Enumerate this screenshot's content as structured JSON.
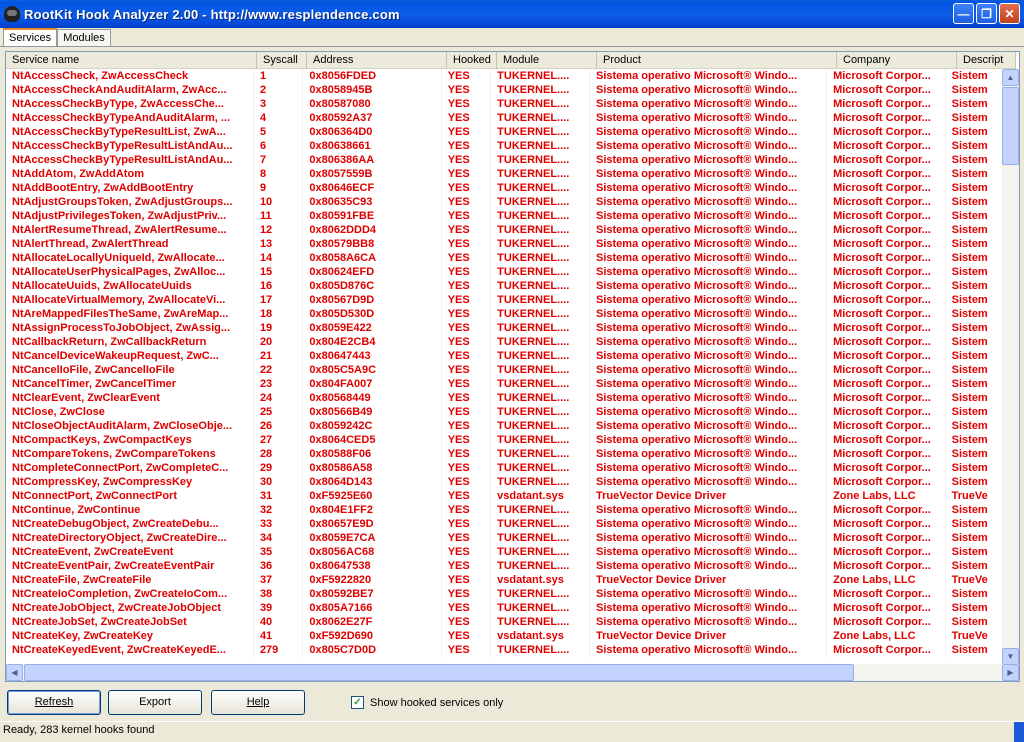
{
  "window": {
    "title": "RootKit Hook Analyzer 2.00 - http://www.resplendence.com"
  },
  "tabs": [
    {
      "label": "Services"
    },
    {
      "label": "Modules"
    }
  ],
  "columns": [
    {
      "label": "Service name"
    },
    {
      "label": "Syscall"
    },
    {
      "label": "Address"
    },
    {
      "label": "Hooked"
    },
    {
      "label": "Module"
    },
    {
      "label": "Product"
    },
    {
      "label": "Company"
    },
    {
      "label": "Descript"
    }
  ],
  "rows": [
    [
      "NtAccessCheck, ZwAccessCheck",
      "1",
      "0x8056FDED",
      "YES",
      "TUKERNEL....",
      "Sistema operativo Microsoft® Windo...",
      "Microsoft Corpor...",
      "Sistem"
    ],
    [
      "NtAccessCheckAndAuditAlarm, ZwAcc...",
      "2",
      "0x8058945B",
      "YES",
      "TUKERNEL....",
      "Sistema operativo Microsoft® Windo...",
      "Microsoft Corpor...",
      "Sistem"
    ],
    [
      "NtAccessCheckByType, ZwAccessChe...",
      "3",
      "0x80587080",
      "YES",
      "TUKERNEL....",
      "Sistema operativo Microsoft® Windo...",
      "Microsoft Corpor...",
      "Sistem"
    ],
    [
      "NtAccessCheckByTypeAndAuditAlarm, ...",
      "4",
      "0x80592A37",
      "YES",
      "TUKERNEL....",
      "Sistema operativo Microsoft® Windo...",
      "Microsoft Corpor...",
      "Sistem"
    ],
    [
      "NtAccessCheckByTypeResultList, ZwA...",
      "5",
      "0x806364D0",
      "YES",
      "TUKERNEL....",
      "Sistema operativo Microsoft® Windo...",
      "Microsoft Corpor...",
      "Sistem"
    ],
    [
      "NtAccessCheckByTypeResultListAndAu...",
      "6",
      "0x80638661",
      "YES",
      "TUKERNEL....",
      "Sistema operativo Microsoft® Windo...",
      "Microsoft Corpor...",
      "Sistem"
    ],
    [
      "NtAccessCheckByTypeResultListAndAu...",
      "7",
      "0x806386AA",
      "YES",
      "TUKERNEL....",
      "Sistema operativo Microsoft® Windo...",
      "Microsoft Corpor...",
      "Sistem"
    ],
    [
      "NtAddAtom, ZwAddAtom",
      "8",
      "0x8057559B",
      "YES",
      "TUKERNEL....",
      "Sistema operativo Microsoft® Windo...",
      "Microsoft Corpor...",
      "Sistem"
    ],
    [
      "NtAddBootEntry, ZwAddBootEntry",
      "9",
      "0x80646ECF",
      "YES",
      "TUKERNEL....",
      "Sistema operativo Microsoft® Windo...",
      "Microsoft Corpor...",
      "Sistem"
    ],
    [
      "NtAdjustGroupsToken, ZwAdjustGroups...",
      "10",
      "0x80635C93",
      "YES",
      "TUKERNEL....",
      "Sistema operativo Microsoft® Windo...",
      "Microsoft Corpor...",
      "Sistem"
    ],
    [
      "NtAdjustPrivilegesToken, ZwAdjustPriv...",
      "11",
      "0x80591FBE",
      "YES",
      "TUKERNEL....",
      "Sistema operativo Microsoft® Windo...",
      "Microsoft Corpor...",
      "Sistem"
    ],
    [
      "NtAlertResumeThread, ZwAlertResume...",
      "12",
      "0x8062DDD4",
      "YES",
      "TUKERNEL....",
      "Sistema operativo Microsoft® Windo...",
      "Microsoft Corpor...",
      "Sistem"
    ],
    [
      "NtAlertThread, ZwAlertThread",
      "13",
      "0x80579BB8",
      "YES",
      "TUKERNEL....",
      "Sistema operativo Microsoft® Windo...",
      "Microsoft Corpor...",
      "Sistem"
    ],
    [
      "NtAllocateLocallyUniqueId, ZwAllocate...",
      "14",
      "0x8058A6CA",
      "YES",
      "TUKERNEL....",
      "Sistema operativo Microsoft® Windo...",
      "Microsoft Corpor...",
      "Sistem"
    ],
    [
      "NtAllocateUserPhysicalPages, ZwAlloc...",
      "15",
      "0x80624EFD",
      "YES",
      "TUKERNEL....",
      "Sistema operativo Microsoft® Windo...",
      "Microsoft Corpor...",
      "Sistem"
    ],
    [
      "NtAllocateUuids, ZwAllocateUuids",
      "16",
      "0x805D876C",
      "YES",
      "TUKERNEL....",
      "Sistema operativo Microsoft® Windo...",
      "Microsoft Corpor...",
      "Sistem"
    ],
    [
      "NtAllocateVirtualMemory, ZwAllocateVi...",
      "17",
      "0x80567D9D",
      "YES",
      "TUKERNEL....",
      "Sistema operativo Microsoft® Windo...",
      "Microsoft Corpor...",
      "Sistem"
    ],
    [
      "NtAreMappedFilesTheSame, ZwAreMap...",
      "18",
      "0x805D530D",
      "YES",
      "TUKERNEL....",
      "Sistema operativo Microsoft® Windo...",
      "Microsoft Corpor...",
      "Sistem"
    ],
    [
      "NtAssignProcessToJobObject, ZwAssig...",
      "19",
      "0x8059E422",
      "YES",
      "TUKERNEL....",
      "Sistema operativo Microsoft® Windo...",
      "Microsoft Corpor...",
      "Sistem"
    ],
    [
      "NtCallbackReturn, ZwCallbackReturn",
      "20",
      "0x804E2CB4",
      "YES",
      "TUKERNEL....",
      "Sistema operativo Microsoft® Windo...",
      "Microsoft Corpor...",
      "Sistem"
    ],
    [
      "NtCancelDeviceWakeupRequest, ZwC...",
      "21",
      "0x80647443",
      "YES",
      "TUKERNEL....",
      "Sistema operativo Microsoft® Windo...",
      "Microsoft Corpor...",
      "Sistem"
    ],
    [
      "NtCancelIoFile, ZwCancelIoFile",
      "22",
      "0x805C5A9C",
      "YES",
      "TUKERNEL....",
      "Sistema operativo Microsoft® Windo...",
      "Microsoft Corpor...",
      "Sistem"
    ],
    [
      "NtCancelTimer, ZwCancelTimer",
      "23",
      "0x804FA007",
      "YES",
      "TUKERNEL....",
      "Sistema operativo Microsoft® Windo...",
      "Microsoft Corpor...",
      "Sistem"
    ],
    [
      "NtClearEvent, ZwClearEvent",
      "24",
      "0x80568449",
      "YES",
      "TUKERNEL....",
      "Sistema operativo Microsoft® Windo...",
      "Microsoft Corpor...",
      "Sistem"
    ],
    [
      "NtClose, ZwClose",
      "25",
      "0x80566B49",
      "YES",
      "TUKERNEL....",
      "Sistema operativo Microsoft® Windo...",
      "Microsoft Corpor...",
      "Sistem"
    ],
    [
      "NtCloseObjectAuditAlarm, ZwCloseObje...",
      "26",
      "0x8059242C",
      "YES",
      "TUKERNEL....",
      "Sistema operativo Microsoft® Windo...",
      "Microsoft Corpor...",
      "Sistem"
    ],
    [
      "NtCompactKeys, ZwCompactKeys",
      "27",
      "0x8064CED5",
      "YES",
      "TUKERNEL....",
      "Sistema operativo Microsoft® Windo...",
      "Microsoft Corpor...",
      "Sistem"
    ],
    [
      "NtCompareTokens, ZwCompareTokens",
      "28",
      "0x80588F06",
      "YES",
      "TUKERNEL....",
      "Sistema operativo Microsoft® Windo...",
      "Microsoft Corpor...",
      "Sistem"
    ],
    [
      "NtCompleteConnectPort, ZwCompleteC...",
      "29",
      "0x80586A58",
      "YES",
      "TUKERNEL....",
      "Sistema operativo Microsoft® Windo...",
      "Microsoft Corpor...",
      "Sistem"
    ],
    [
      "NtCompressKey, ZwCompressKey",
      "30",
      "0x8064D143",
      "YES",
      "TUKERNEL....",
      "Sistema operativo Microsoft® Windo...",
      "Microsoft Corpor...",
      "Sistem"
    ],
    [
      "NtConnectPort, ZwConnectPort",
      "31",
      "0xF5925E60",
      "YES",
      "vsdatant.sys",
      "TrueVector Device Driver",
      "Zone Labs, LLC",
      "TrueVe"
    ],
    [
      "NtContinue, ZwContinue",
      "32",
      "0x804E1FF2",
      "YES",
      "TUKERNEL....",
      "Sistema operativo Microsoft® Windo...",
      "Microsoft Corpor...",
      "Sistem"
    ],
    [
      "NtCreateDebugObject, ZwCreateDebu...",
      "33",
      "0x80657E9D",
      "YES",
      "TUKERNEL....",
      "Sistema operativo Microsoft® Windo...",
      "Microsoft Corpor...",
      "Sistem"
    ],
    [
      "NtCreateDirectoryObject, ZwCreateDire...",
      "34",
      "0x8059E7CA",
      "YES",
      "TUKERNEL....",
      "Sistema operativo Microsoft® Windo...",
      "Microsoft Corpor...",
      "Sistem"
    ],
    [
      "NtCreateEvent, ZwCreateEvent",
      "35",
      "0x8056AC68",
      "YES",
      "TUKERNEL....",
      "Sistema operativo Microsoft® Windo...",
      "Microsoft Corpor...",
      "Sistem"
    ],
    [
      "NtCreateEventPair, ZwCreateEventPair",
      "36",
      "0x80647538",
      "YES",
      "TUKERNEL....",
      "Sistema operativo Microsoft® Windo...",
      "Microsoft Corpor...",
      "Sistem"
    ],
    [
      "NtCreateFile, ZwCreateFile",
      "37",
      "0xF5922820",
      "YES",
      "vsdatant.sys",
      "TrueVector Device Driver",
      "Zone Labs, LLC",
      "TrueVe"
    ],
    [
      "NtCreateIoCompletion, ZwCreateIoCom...",
      "38",
      "0x80592BE7",
      "YES",
      "TUKERNEL....",
      "Sistema operativo Microsoft® Windo...",
      "Microsoft Corpor...",
      "Sistem"
    ],
    [
      "NtCreateJobObject, ZwCreateJobObject",
      "39",
      "0x805A7166",
      "YES",
      "TUKERNEL....",
      "Sistema operativo Microsoft® Windo...",
      "Microsoft Corpor...",
      "Sistem"
    ],
    [
      "NtCreateJobSet, ZwCreateJobSet",
      "40",
      "0x8062E27F",
      "YES",
      "TUKERNEL....",
      "Sistema operativo Microsoft® Windo...",
      "Microsoft Corpor...",
      "Sistem"
    ],
    [
      "NtCreateKey, ZwCreateKey",
      "41",
      "0xF592D690",
      "YES",
      "vsdatant.sys",
      "TrueVector Device Driver",
      "Zone Labs, LLC",
      "TrueVe"
    ],
    [
      "NtCreateKeyedEvent, ZwCreateKeyedE...",
      "279",
      "0x805C7D0D",
      "YES",
      "TUKERNEL....",
      "Sistema operativo Microsoft® Windo...",
      "Microsoft Corpor...",
      "Sistem"
    ]
  ],
  "buttons": {
    "refresh": "Refresh",
    "export": "Export",
    "help": "Help"
  },
  "checkbox": {
    "label": "Show hooked services only",
    "checked": true
  },
  "status": {
    "text": "Ready, 283 kernel hooks found"
  },
  "colors": {
    "hooked_text": "#e00000",
    "titlebar": "#0b5ce6"
  }
}
